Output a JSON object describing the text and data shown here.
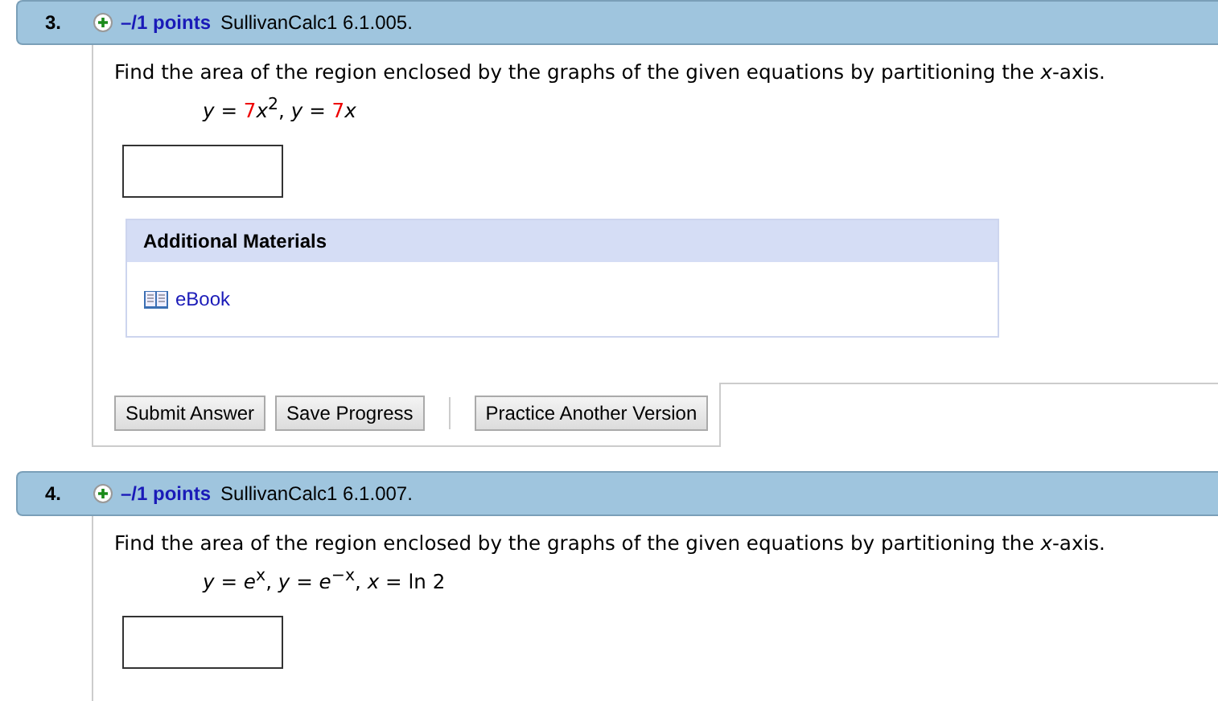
{
  "questions": [
    {
      "number": "3.",
      "points": "–/1 points",
      "source": "SullivanCalc1 6.1.005.",
      "prompt": "Find the area of the region enclosed by the graphs of the given equations by partitioning the *x*-axis.",
      "equation": [
        {
          "text": "*y* = ",
          "highlight": false
        },
        {
          "text": "7",
          "highlight": true
        },
        {
          "text": "*x*$^{2}$, *y* = ",
          "highlight": false
        },
        {
          "text": "7",
          "highlight": true
        },
        {
          "text": "*x*",
          "highlight": false
        }
      ],
      "additional_materials": {
        "title": "Additional Materials",
        "links": [
          "eBook"
        ]
      },
      "buttons": [
        "Submit Answer",
        "Save Progress"
      ],
      "extra_button": "Practice Another Version"
    },
    {
      "number": "4.",
      "points": "–/1 points",
      "source": "SullivanCalc1 6.1.007.",
      "prompt": "Find the area of the region enclosed by the graphs of the given equations by partitioning the *x*-axis.",
      "equation": [
        {
          "text": "*y* = *e*$^{x}$, *y* = *e*$^{−x}$, *x* = ln 2",
          "highlight": false
        }
      ]
    }
  ]
}
